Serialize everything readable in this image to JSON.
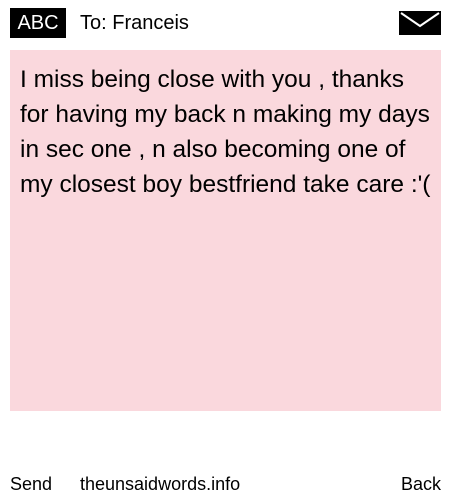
{
  "header": {
    "input_mode_badge": "ABC",
    "to_line": "To: Franceis",
    "message_icon": "envelope-icon"
  },
  "message": {
    "text": "I miss being close with you , thanks for having my back n making my days in sec one , n also becoming one of my closest boy bestfriend take care :'(",
    "background_color": "#fad8dd"
  },
  "footer": {
    "send_label": "Send",
    "site_label": "theunsaidwords.info",
    "back_label": "Back"
  }
}
